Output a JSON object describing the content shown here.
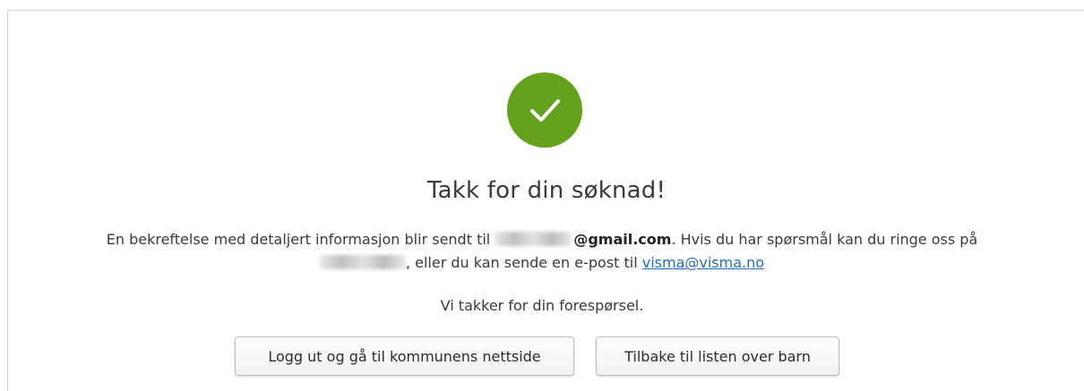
{
  "confirmation": {
    "title": "Takk for din søknad!",
    "message_part1": "En bekreftelse med detaljert informasjon blir sendt til ",
    "email_domain": "@gmail.com",
    "message_part2": ". Hvis du har spørsmål kan du ringe oss på",
    "message_part3": ", eller du kan sende en e-post til ",
    "contact_email": "visma@visma.no",
    "thanks_text": "Vi takker for din forespørsel.",
    "success_color": "#64a11c",
    "link_color": "#2a6db5"
  },
  "icons": {
    "success": "checkmark-circle-icon"
  },
  "actions": {
    "logout_label": "Logg ut og gå til kommunens nettside",
    "back_label": "Tilbake til listen over barn"
  }
}
